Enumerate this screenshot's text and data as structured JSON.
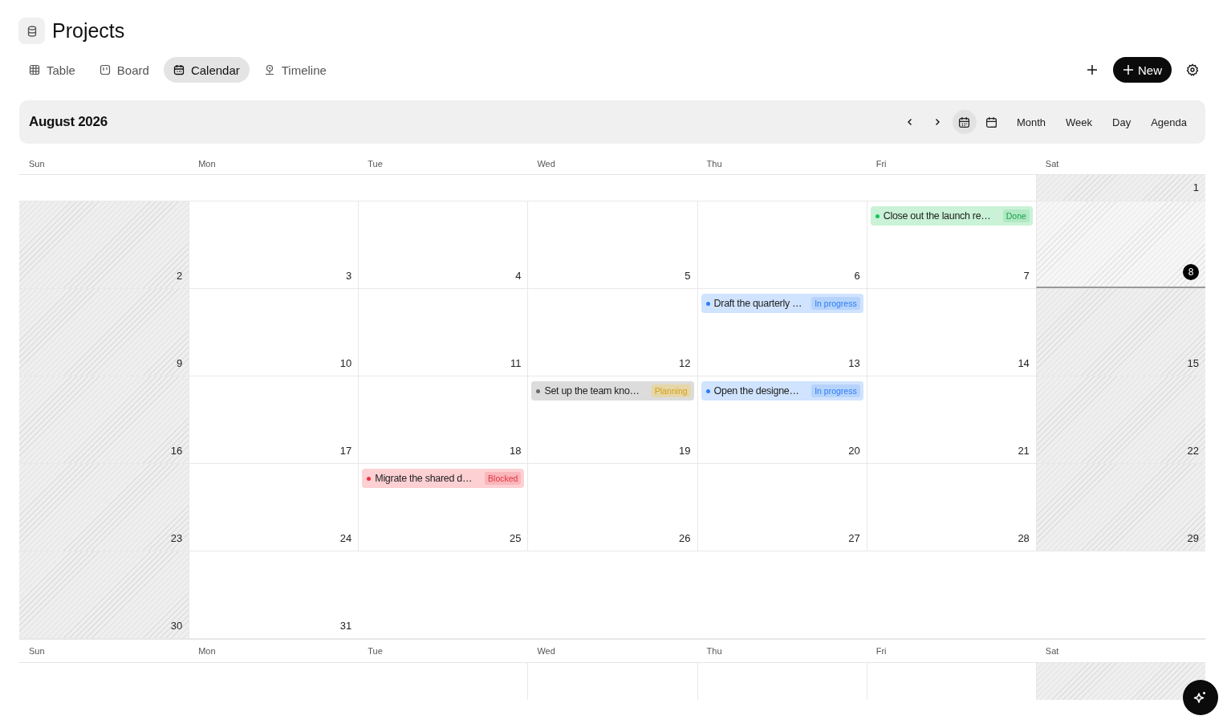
{
  "title": "Projects",
  "tabs": [
    {
      "label": "Table",
      "selected": false
    },
    {
      "label": "Board",
      "selected": false
    },
    {
      "label": "Calendar",
      "selected": true
    },
    {
      "label": "Timeline",
      "selected": false
    }
  ],
  "new_button": "New",
  "calendar": {
    "month": "August 2026",
    "views": [
      {
        "label": "Month"
      },
      {
        "label": "Week"
      },
      {
        "label": "Day"
      },
      {
        "label": "Agenda"
      }
    ],
    "weekdays": [
      "Sun",
      "Mon",
      "Tue",
      "Wed",
      "Thu",
      "Fri",
      "Sat"
    ],
    "weeks": [
      {
        "cells": [
          {
            "kind": "empty"
          },
          {
            "kind": "empty"
          },
          {
            "kind": "empty"
          },
          {
            "kind": "empty"
          },
          {
            "kind": "empty"
          },
          {
            "kind": "empty"
          },
          {
            "kind": "day",
            "day": "1",
            "weekend": true,
            "today": false
          }
        ]
      },
      {
        "cells": [
          {
            "kind": "day",
            "day": "2",
            "weekend": true,
            "today": false
          },
          {
            "kind": "day",
            "day": "3",
            "weekend": false,
            "today": false
          },
          {
            "kind": "day",
            "day": "4",
            "weekend": false,
            "today": false
          },
          {
            "kind": "day",
            "day": "5",
            "weekend": false,
            "today": false
          },
          {
            "kind": "day",
            "day": "6",
            "weekend": false,
            "today": false
          },
          {
            "kind": "day",
            "day": "7",
            "weekend": false,
            "today": false,
            "events": [
              {
                "title": "Close out the launch re…",
                "status": "Done",
                "kind": "done",
                "color": "#16c45a"
              }
            ]
          },
          {
            "kind": "day",
            "day": "8",
            "weekend": true,
            "today": true
          }
        ]
      },
      {
        "cells": [
          {
            "kind": "day",
            "day": "9",
            "weekend": true,
            "today": false
          },
          {
            "kind": "day",
            "day": "10",
            "weekend": false,
            "today": false
          },
          {
            "kind": "day",
            "day": "11",
            "weekend": false,
            "today": false
          },
          {
            "kind": "day",
            "day": "12",
            "weekend": false,
            "today": false
          },
          {
            "kind": "day",
            "day": "13",
            "weekend": false,
            "today": false,
            "events": [
              {
                "title": "Draft the quarterly …",
                "status": "In progress",
                "kind": "progress",
                "color": "#2f7cf6"
              }
            ]
          },
          {
            "kind": "day",
            "day": "14",
            "weekend": false,
            "today": false
          },
          {
            "kind": "day",
            "day": "15",
            "weekend": true,
            "today": false
          }
        ]
      },
      {
        "cells": [
          {
            "kind": "day",
            "day": "16",
            "weekend": true,
            "today": false
          },
          {
            "kind": "day",
            "day": "17",
            "weekend": false,
            "today": false
          },
          {
            "kind": "day",
            "day": "18",
            "weekend": false,
            "today": false
          },
          {
            "kind": "day",
            "day": "19",
            "weekend": false,
            "today": false,
            "events": [
              {
                "title": "Set up the team kno…",
                "status": "Planning",
                "kind": "planning",
                "color": "#6b6b6b"
              }
            ]
          },
          {
            "kind": "day",
            "day": "20",
            "weekend": false,
            "today": false,
            "events": [
              {
                "title": "Open the designe…",
                "status": "In progress",
                "kind": "progress",
                "color": "#2f7cf6"
              }
            ]
          },
          {
            "kind": "day",
            "day": "21",
            "weekend": false,
            "today": false
          },
          {
            "kind": "day",
            "day": "22",
            "weekend": true,
            "today": false
          }
        ]
      },
      {
        "cells": [
          {
            "kind": "day",
            "day": "23",
            "weekend": true,
            "today": false
          },
          {
            "kind": "day",
            "day": "24",
            "weekend": false,
            "today": false
          },
          {
            "kind": "day",
            "day": "25",
            "weekend": false,
            "today": false,
            "events": [
              {
                "title": "Migrate the shared d…",
                "status": "Blocked",
                "kind": "blocked",
                "color": "#ef2d3c"
              }
            ]
          },
          {
            "kind": "day",
            "day": "26",
            "weekend": false,
            "today": false
          },
          {
            "kind": "day",
            "day": "27",
            "weekend": false,
            "today": false
          },
          {
            "kind": "day",
            "day": "28",
            "weekend": false,
            "today": false
          },
          {
            "kind": "day",
            "day": "29",
            "weekend": true,
            "today": false
          }
        ]
      },
      {
        "cells": [
          {
            "kind": "day",
            "day": "30",
            "weekend": true,
            "today": false
          },
          {
            "kind": "day",
            "day": "31",
            "weekend": false,
            "today": false
          },
          {
            "kind": "empty"
          },
          {
            "kind": "empty"
          },
          {
            "kind": "empty"
          },
          {
            "kind": "empty"
          },
          {
            "kind": "empty"
          }
        ]
      }
    ],
    "next_weekdays": [
      "Sun",
      "Mon",
      "Tue",
      "Wed",
      "Thu",
      "Fri",
      "Sat"
    ],
    "next_row": [
      {
        "kind": "empty"
      },
      {
        "kind": "empty"
      },
      {
        "kind": "empty"
      },
      {
        "kind": "blank"
      },
      {
        "kind": "blank"
      },
      {
        "kind": "blank"
      },
      {
        "kind": "hatched"
      }
    ]
  }
}
